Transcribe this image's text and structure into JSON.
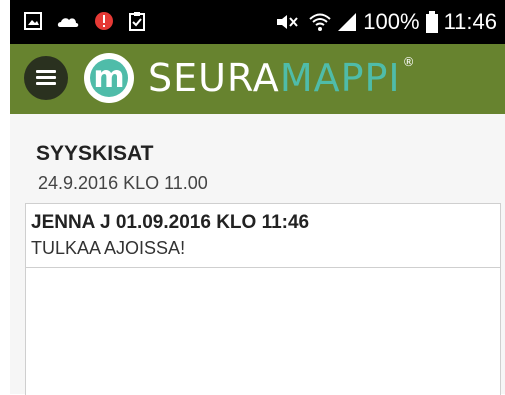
{
  "status_bar": {
    "battery": "100%",
    "time": "11:46",
    "icons": [
      "image-icon",
      "cloud-icon",
      "alert-icon",
      "clipboard-icon",
      "mute-icon",
      "wifi-icon",
      "signal-icon",
      "battery-icon"
    ]
  },
  "app_bar": {
    "brand_part1": "SEURA",
    "brand_part2": "MAPPI",
    "registered": "®",
    "logo_letter": "m",
    "colors": {
      "bar": "#67832f",
      "accent": "#4fbca9",
      "menu": "#2a311f"
    }
  },
  "event": {
    "title": "SYYSKISAT",
    "date": "24.9.2016 KLO 11.00"
  },
  "message": {
    "meta": "JENNA J 01.09.2016 KLO 11:46",
    "text": "TULKAA AJOISSA!"
  }
}
